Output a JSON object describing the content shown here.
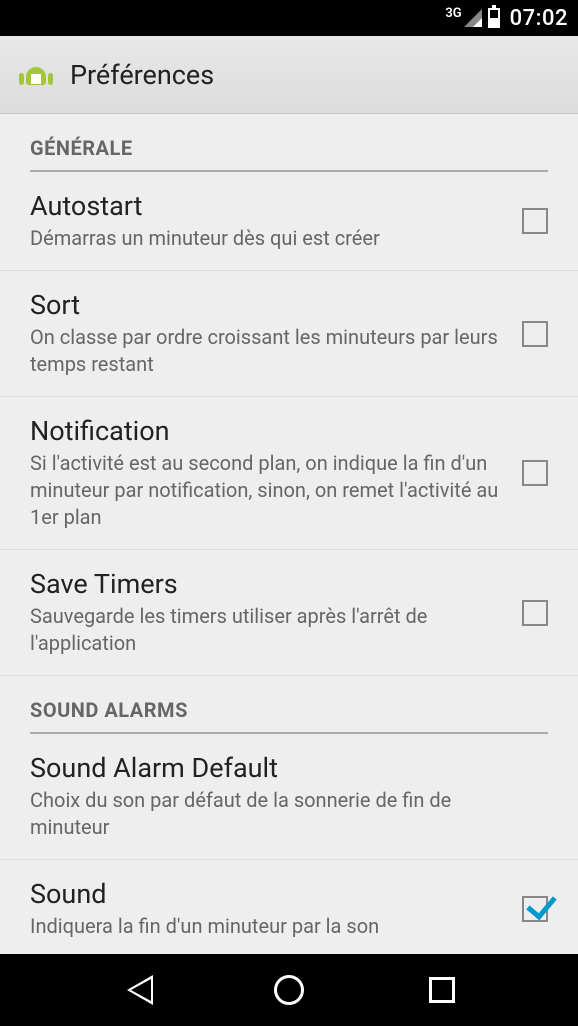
{
  "status": {
    "network": "3G",
    "time": "07:02"
  },
  "app": {
    "title": "Préférences"
  },
  "sections": {
    "general": {
      "header": "GÉNÉRALE",
      "items": {
        "autostart": {
          "title": "Autostart",
          "summary": "Démarras un minuteur dès qui est créer",
          "checked": false
        },
        "sort": {
          "title": "Sort",
          "summary": "On classe par ordre croissant les minuteurs par leurs temps restant",
          "checked": false
        },
        "notification": {
          "title": "Notification",
          "summary": "Si l'activité est au second plan, on indique la fin d'un minuteur par notification, sinon, on remet l'activité au 1er plan",
          "checked": false
        },
        "save": {
          "title": "Save Timers",
          "summary": "Sauvegarde les timers utiliser après l'arrêt de l'application",
          "checked": false
        }
      }
    },
    "sound": {
      "header": "SOUND ALARMS",
      "items": {
        "default": {
          "title": "Sound Alarm Default",
          "summary": "Choix du son par défaut de la sonnerie de fin de minuteur"
        },
        "sound": {
          "title": "Sound",
          "summary": "Indiquera la fin d'un minuteur par la son",
          "checked": true
        }
      }
    }
  }
}
